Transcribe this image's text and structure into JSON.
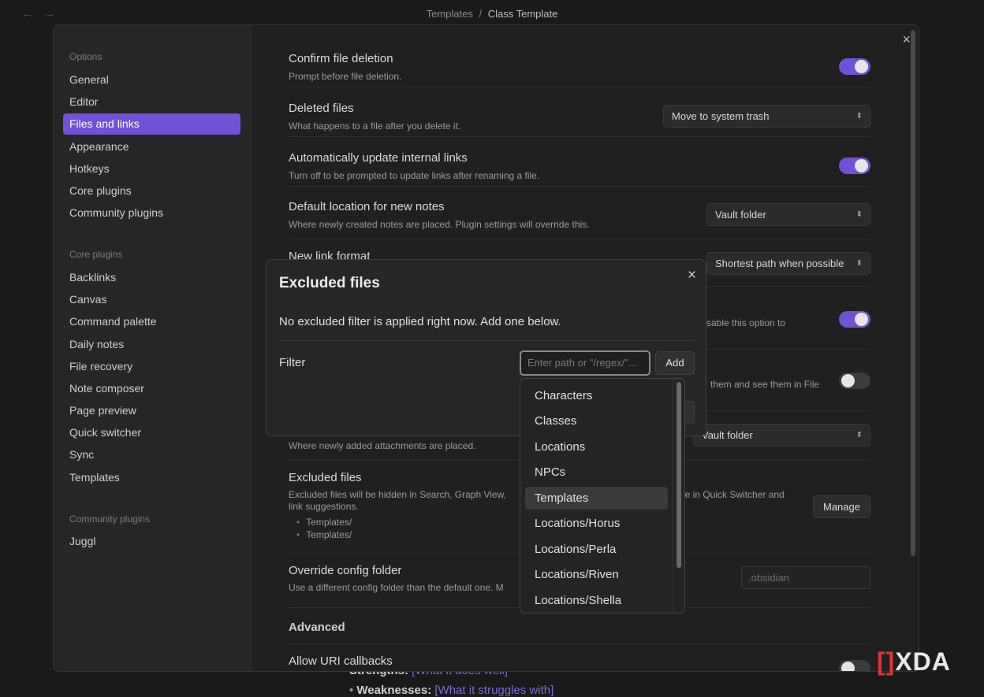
{
  "topbar": {
    "back_icon": "←",
    "forward_icon": "→",
    "breadcrumb_parent": "Templates",
    "breadcrumb_sep": "/",
    "breadcrumb_current": "Class Template"
  },
  "background_note": {
    "strengths_label": "Strengths:",
    "strengths_link": "[What it does well]",
    "weaknesses_label": "Weaknesses:",
    "weaknesses_link": "[What it struggles with]"
  },
  "sidebar": {
    "options_heading": "Options",
    "options_items": [
      "General",
      "Editor",
      "Files and links",
      "Appearance",
      "Hotkeys",
      "Core plugins",
      "Community plugins"
    ],
    "core_heading": "Core plugins",
    "core_items": [
      "Backlinks",
      "Canvas",
      "Command palette",
      "Daily notes",
      "File recovery",
      "Note composer",
      "Page preview",
      "Quick switcher",
      "Sync",
      "Templates"
    ],
    "community_heading": "Community plugins",
    "community_items": [
      "Juggl"
    ],
    "active_item": "Files and links"
  },
  "settings": {
    "close_icon": "×",
    "confirm_deletion": {
      "title": "Confirm file deletion",
      "desc": "Prompt before file deletion.",
      "enabled": true
    },
    "deleted_files": {
      "title": "Deleted files",
      "desc": "What happens to a file after you delete it.",
      "value": "Move to system trash"
    },
    "auto_update_links": {
      "title": "Automatically update internal links",
      "desc": "Turn off to be prompted to update links after renaming a file.",
      "enabled": true
    },
    "default_location": {
      "title": "Default location for new notes",
      "desc": "Where newly created notes are placed. Plugin settings will override this.",
      "value": "Vault folder"
    },
    "new_link_format": {
      "title": "New link format",
      "value": "Shortest path when possible"
    },
    "wikilinks": {
      "desc_partial": "sable this option to",
      "enabled": true
    },
    "detect_all_ext": {
      "desc_partial": "them and see them in File",
      "enabled": false
    },
    "attachments": {
      "desc": "Where newly added attachments are placed.",
      "value": "Vault folder",
      "value_partial": "Vault folder"
    },
    "excluded_files": {
      "title": "Excluded files",
      "desc_left": "Excluded files will be hidden in Search, Graph View,",
      "desc_right": "le in Quick Switcher and",
      "desc_line2": "link suggestions.",
      "list": [
        "Templates/",
        "Templates/"
      ],
      "button": "Manage"
    },
    "override_config": {
      "title": "Override config folder",
      "desc": "Use a different config folder than the default one. M",
      "placeholder": ".obsidian"
    },
    "advanced_heading": "Advanced",
    "uri_callbacks": {
      "title": "Allow URI callbacks",
      "enabled": false
    }
  },
  "dialog": {
    "title": "Excluded files",
    "close_icon": "×",
    "message": "No excluded filter is applied right now. Add one below.",
    "filter_label": "Filter",
    "filter_placeholder": "Enter path or \"/regex/\"...",
    "add_button": "Add"
  },
  "suggestions": {
    "items": [
      "Characters",
      "Classes",
      "Locations",
      "NPCs",
      "Templates",
      "Locations/Horus",
      "Locations/Perla",
      "Locations/Riven",
      "Locations/Shella"
    ],
    "selected": "Templates"
  },
  "watermark": {
    "bracket": "[",
    "bracket_close": "]",
    "text": "XDA"
  },
  "colors": {
    "accent": "#7152d6",
    "background": "#1a1a1a",
    "panel": "#202020",
    "sidebar": "#262626"
  }
}
